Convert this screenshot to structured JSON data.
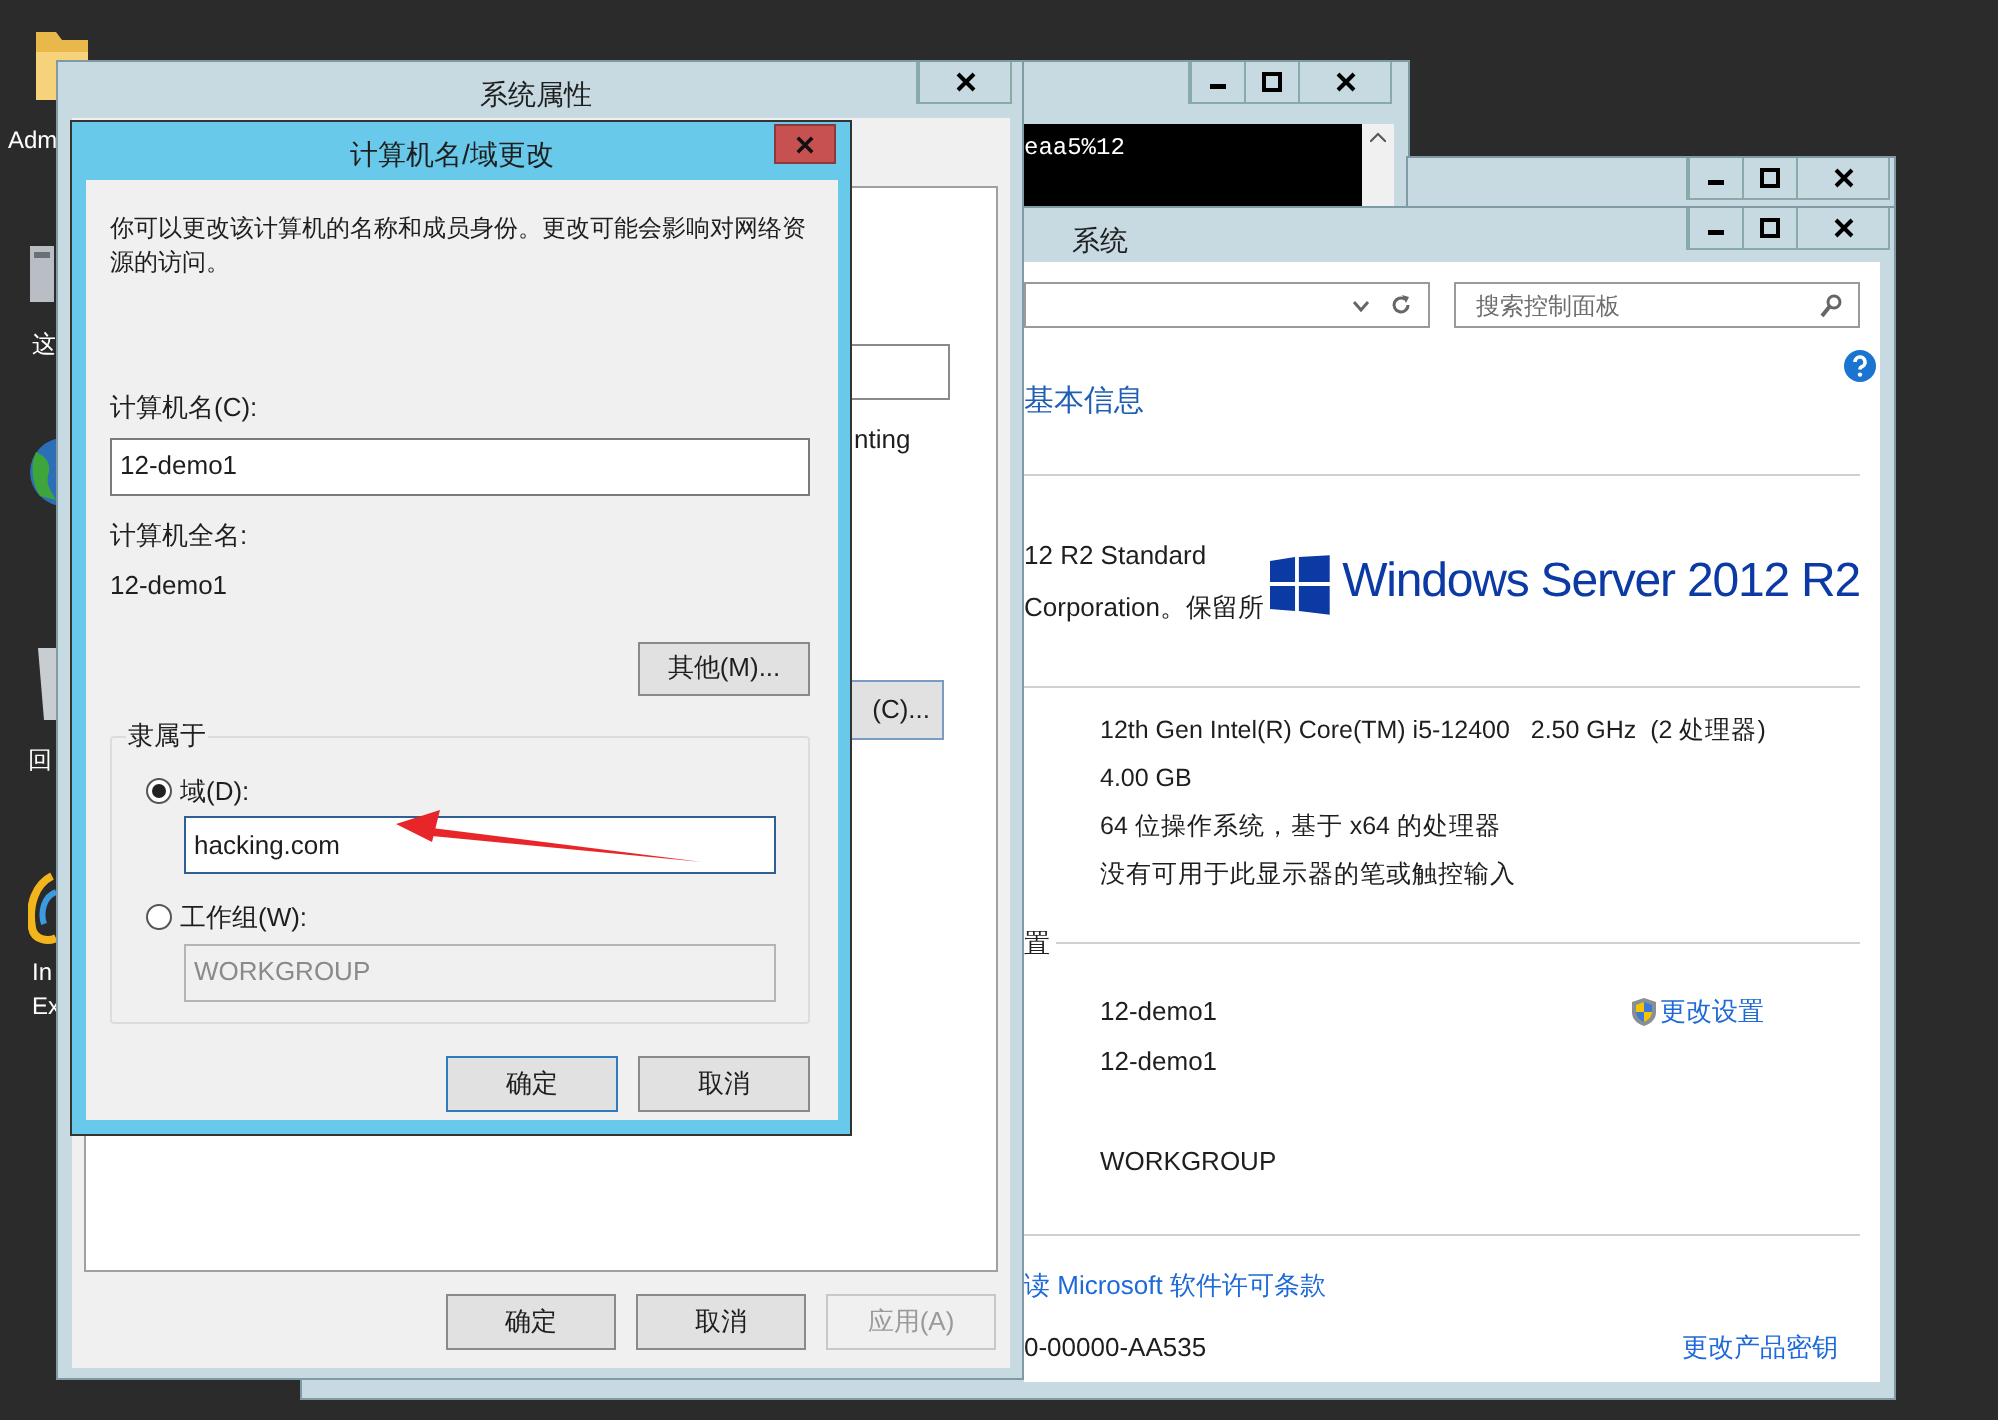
{
  "desktop_icons": [
    {
      "kind": "folder",
      "label_lines": [
        "Adm"
      ]
    },
    {
      "kind": "computer",
      "label_lines": [
        "这"
      ]
    },
    {
      "kind": "globe"
    },
    {
      "kind": "recycle_bin",
      "label_lines": [
        "回"
      ]
    },
    {
      "kind": "browser",
      "label_lines": [
        "In",
        "Ex"
      ]
    }
  ],
  "console_window": {
    "output": "eaa5%12"
  },
  "system_window": {
    "title": "系统",
    "search": {
      "placeholder": "搜索控制面板"
    },
    "heading": "基本信息",
    "edition_lines": [
      "12 R2 Standard",
      "Corporation。保留所"
    ],
    "logo_text": "Windows Server 2012 R2",
    "specs": [
      "12th Gen Intel(R) Core(TM) i5-12400   2.50 GHz  (2 处理器)",
      "4.00 GB",
      "64 位操作系统，基于 x64 的处理器",
      "没有可用于此显示器的笔或触控输入"
    ],
    "settings_heading": "置",
    "settings_rows": [
      {
        "value": "12-demo1",
        "link": "更改设置"
      },
      {
        "value": "12-demo1"
      },
      {
        "value": "WORKGROUP"
      }
    ],
    "license_link": "读 Microsoft 软件许可条款",
    "product_id": "0-00000-AA535",
    "product_key_link": "更改产品密钥"
  },
  "system_properties": {
    "title": "系统属性",
    "partial_text": "nting",
    "partial_button": "(C)...",
    "buttons": [
      {
        "label": "确定",
        "disabled": false
      },
      {
        "label": "取消",
        "disabled": false
      },
      {
        "label": "应用(A)",
        "disabled": true
      }
    ]
  },
  "dialog": {
    "title": "计算机名/域更改",
    "description": "你可以更改该计算机的名称和成员身份。更改可能会影响对网络资源的访问。",
    "computer_name_label": "计算机名(C):",
    "computer_name": "12-demo1",
    "full_name_label": "计算机全名:",
    "full_name": "12-demo1",
    "more_button": "其他(M)...",
    "member_of": {
      "label": "隶属于",
      "options": [
        {
          "label": "域(D):",
          "selected": true,
          "value": "hacking.com"
        },
        {
          "label": "工作组(W):",
          "selected": false,
          "value": "WORKGROUP"
        }
      ]
    },
    "buttons": [
      {
        "label": "确定",
        "default": true
      },
      {
        "label": "取消",
        "default": false
      }
    ]
  }
}
